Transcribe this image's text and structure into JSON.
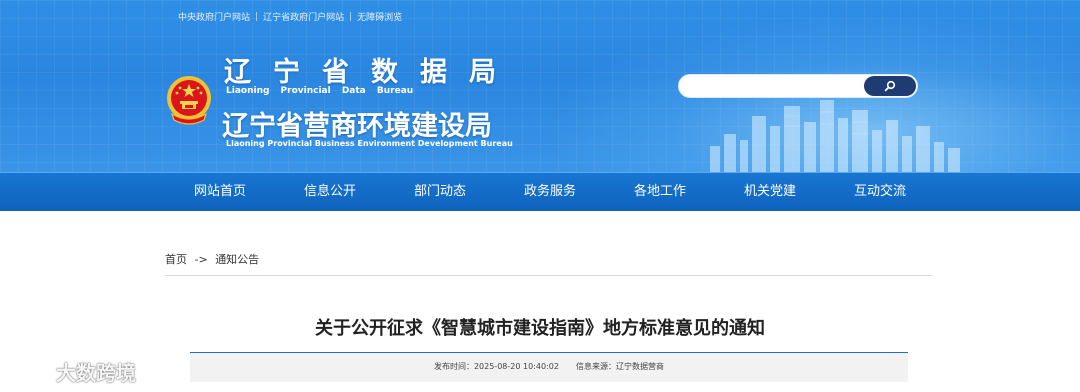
{
  "top_links": [
    "中央政府门户网站",
    "辽宁省政府门户网站",
    "无障碍浏览"
  ],
  "brand": {
    "title_primary": "辽宁省数据局",
    "subtitle_primary": "Liaoning Provincial Data Bureau",
    "title_secondary": "辽宁省营商环境建设局",
    "subtitle_secondary": "Liaoning Provincial Business Environment Development Bureau",
    "emblem_icon": "national-emblem-icon"
  },
  "search": {
    "placeholder": "",
    "button_icon": "search-icon"
  },
  "nav": {
    "items": [
      "网站首页",
      "信息公开",
      "部门动态",
      "政务服务",
      "各地工作",
      "机关党建",
      "互动交流"
    ]
  },
  "breadcrumb": {
    "home": "首页",
    "arrow": "->",
    "current": "通知公告"
  },
  "article": {
    "title": "关于公开征求《智慧城市建设指南》地方标准意见的通知",
    "publish_time": "发布时间：2025-08-20 10:40:02",
    "source": "信息来源：辽宁数据营商"
  },
  "watermark": {
    "text": "大数跨境"
  },
  "colors": {
    "header_blue": "#2a86df",
    "nav_blue": "#1470cc",
    "search_button": "#1f3c72",
    "meta_border": "#1f6fc6"
  }
}
